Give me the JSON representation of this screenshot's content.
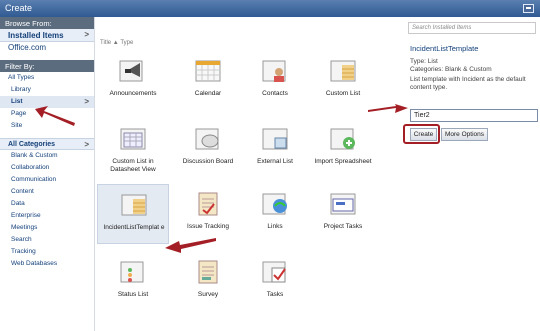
{
  "window": {
    "title": "Create"
  },
  "left_panel": {
    "browse_header": "Browse From:",
    "installed_items": "Installed Items",
    "office": "Office.com",
    "filter_header": "Filter By:",
    "filters": [
      "All Types",
      "Library",
      "List",
      "Page",
      "Site"
    ],
    "categories_header": "All Categories",
    "categories": [
      "Blank & Custom",
      "Collaboration",
      "Communication",
      "Content",
      "Data",
      "Enterprise",
      "Meetings",
      "Search",
      "Tracking",
      "Web Databases"
    ]
  },
  "sort": {
    "title": "Title",
    "sep": "▲",
    "type": "Type"
  },
  "tiles": [
    {
      "label": "Announcements",
      "icon": "announcements-icon"
    },
    {
      "label": "Calendar",
      "icon": "calendar-icon"
    },
    {
      "label": "Contacts",
      "icon": "contacts-icon"
    },
    {
      "label": "Custom List",
      "icon": "custom-list-icon"
    },
    {
      "label": "Custom List in Datasheet View",
      "icon": "datasheet-icon"
    },
    {
      "label": "Discussion Board",
      "icon": "discussion-board-icon"
    },
    {
      "label": "External List",
      "icon": "external-list-icon"
    },
    {
      "label": "Import Spreadsheet",
      "icon": "import-spreadsheet-icon"
    },
    {
      "label": "IncidentListTemplat e",
      "icon": "incident-list-icon"
    },
    {
      "label": "Issue Tracking",
      "icon": "issue-tracking-icon"
    },
    {
      "label": "Links",
      "icon": "links-icon"
    },
    {
      "label": "Project Tasks",
      "icon": "project-tasks-icon"
    },
    {
      "label": "Status List",
      "icon": "status-list-icon"
    },
    {
      "label": "Survey",
      "icon": "survey-icon"
    },
    {
      "label": "Tasks",
      "icon": "tasks-icon"
    }
  ],
  "details": {
    "search_placeholder": "Search Installed Items",
    "title": "IncidentListTemplate",
    "type_line": "Type: List",
    "category_line": "Categories: Blank & Custom",
    "description": "List template with Incident as the default content type.",
    "name_value": "Tier2",
    "create_label": "Create",
    "more_options_label": "More Options"
  },
  "colors": {
    "accent": "#13407a",
    "highlight": "#a31f25",
    "title_bar": "#3d6aa3"
  }
}
